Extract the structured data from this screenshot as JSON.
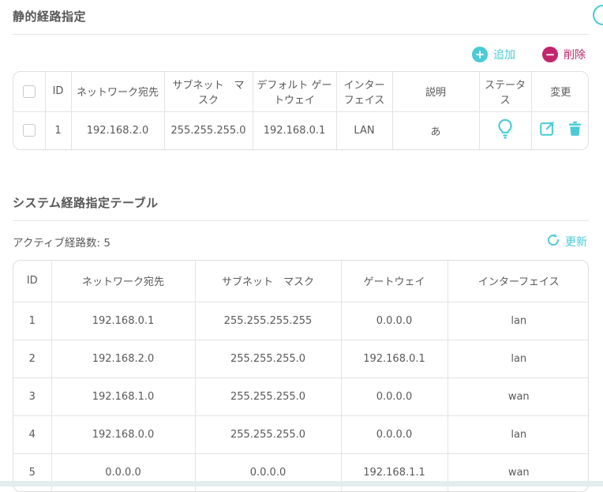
{
  "colors": {
    "teal": "#4acbd6",
    "magenta": "#c2256b"
  },
  "section1": {
    "title": "静的経路指定",
    "toolbar": {
      "add_label": "追加",
      "delete_label": "削除"
    },
    "table": {
      "headers": {
        "id": "ID",
        "dest": "ネットワーク宛先",
        "mask": "サブネット　マスク",
        "gateway": "デフォルト ゲートウェイ",
        "iface": "インターフェイス",
        "desc": "説明",
        "status": "ステータス",
        "change": "変更"
      },
      "rows": [
        {
          "id": "1",
          "dest": "192.168.2.0",
          "mask": "255.255.255.0",
          "gateway": "192.168.0.1",
          "iface": "LAN",
          "desc": "あ"
        }
      ],
      "icons": {
        "status": "lightbulb-icon",
        "edit": "edit-icon",
        "delete": "trash-icon"
      }
    }
  },
  "section2": {
    "title": "システム経路指定テーブル",
    "active_routes_label": "アクティブ経路数:",
    "active_routes_count": "5",
    "refresh_label": "更新",
    "table": {
      "headers": [
        "ID",
        "ネットワーク宛先",
        "サブネット　マスク",
        "ゲートウェイ",
        "インターフェイス"
      ],
      "rows": [
        [
          "1",
          "192.168.0.1",
          "255.255.255.255",
          "0.0.0.0",
          "lan"
        ],
        [
          "2",
          "192.168.2.0",
          "255.255.255.0",
          "192.168.0.1",
          "lan"
        ],
        [
          "3",
          "192.168.1.0",
          "255.255.255.0",
          "0.0.0.0",
          "wan"
        ],
        [
          "4",
          "192.168.0.0",
          "255.255.255.0",
          "0.0.0.0",
          "lan"
        ],
        [
          "5",
          "0.0.0.0",
          "0.0.0.0",
          "192.168.1.1",
          "wan"
        ]
      ]
    }
  }
}
